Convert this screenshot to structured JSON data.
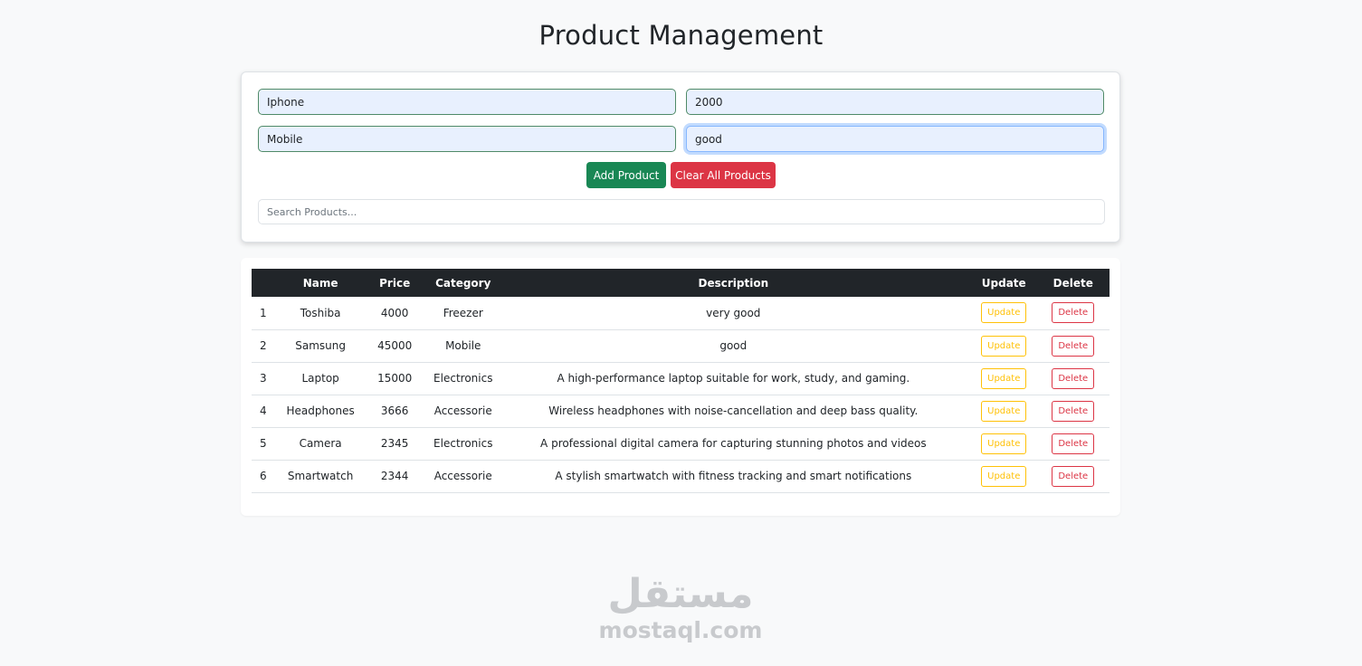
{
  "page": {
    "title": "Product Management"
  },
  "form": {
    "name_value": "Iphone",
    "price_value": "2000",
    "category_value": "Mobile",
    "description_value": "good",
    "add_label": "Add Product",
    "clear_label": "Clear All Products",
    "search_placeholder": "Search Products..."
  },
  "table": {
    "headers": [
      "",
      "Name",
      "Price",
      "Category",
      "Description",
      "Update",
      "Delete"
    ],
    "update_label": "Update",
    "delete_label": "Delete",
    "rows": [
      [
        "1",
        "Toshiba",
        "4000",
        "Freezer",
        "very good"
      ],
      [
        "2",
        "Samsung",
        "45000",
        "Mobile",
        "good"
      ],
      [
        "3",
        "Laptop",
        "15000",
        "Electronics",
        "A high-performance laptop suitable for work, study, and gaming."
      ],
      [
        "4",
        "Headphones",
        "3666",
        "Accessorie",
        "Wireless headphones with noise-cancellation and deep bass quality."
      ],
      [
        "5",
        "Camera",
        "2345",
        "Electronics",
        "A professional digital camera for capturing stunning photos and videos"
      ],
      [
        "6",
        "Smartwatch",
        "2344",
        "Accessorie",
        "A stylish smartwatch with fitness tracking and smart notifications"
      ]
    ]
  },
  "watermark": {
    "arabic": "مستقل",
    "latin": "mostaql.com"
  },
  "colors": {
    "success": "#198754",
    "danger": "#dc3545",
    "warning": "#ffc107",
    "header_dark": "#212529",
    "field_fill": "#e8f0fe"
  }
}
